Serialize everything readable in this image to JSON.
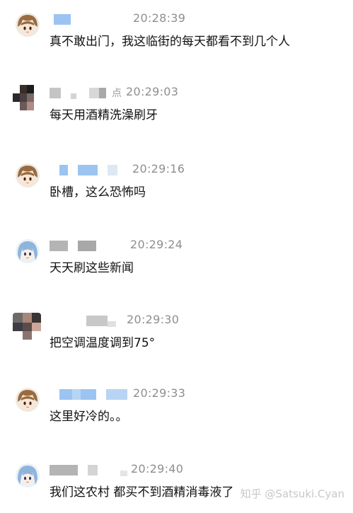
{
  "colors": {
    "time": "#8e8e8e",
    "message_text": "#111111",
    "blue_blur": "#9cc4f2",
    "gray_blur": "#c4c4c4",
    "watermark": "#c8c8c8"
  },
  "messages": [
    {
      "avatar": "brown-hair-anime-avatar",
      "time": "20:28:39",
      "text": "真不敢出门，我这临街的每天都看不到几个人"
    },
    {
      "avatar": "dark-pixelated-avatar",
      "name_suffix": "点",
      "time": "20:29:03",
      "text": "每天用酒精洗澡刷牙"
    },
    {
      "avatar": "brown-hair-anime-avatar",
      "time": "20:29:16",
      "text": "卧槽，这么恐怖吗"
    },
    {
      "avatar": "blue-hair-anime-avatar",
      "time": "20:29:24",
      "text": "天天刷这些新闻"
    },
    {
      "avatar": "dark-pixelated-avatar",
      "time": "20:29:30",
      "text": "把空调温度调到75°"
    },
    {
      "avatar": "brown-hair-anime-avatar",
      "time": "20:29:33",
      "text": "这里好冷的。。"
    },
    {
      "avatar": "blue-hair-anime-avatar",
      "time": "20:29:40",
      "text": "我们这农村 都买不到酒精消毒液了"
    }
  ],
  "watermark": "知乎 @Satsuki.Cyan"
}
